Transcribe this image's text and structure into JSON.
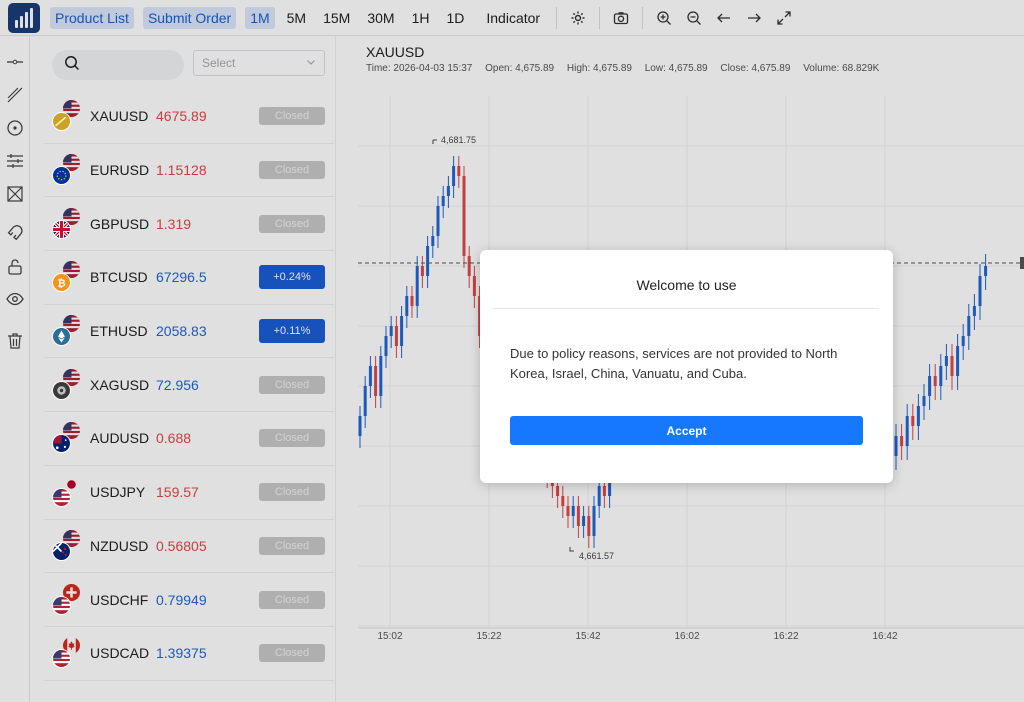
{
  "toolbar": {
    "nav": [
      "Product List",
      "Submit Order"
    ],
    "timeframes": [
      "1M",
      "5M",
      "15M",
      "30M",
      "1H",
      "1D"
    ],
    "active_timeframe": "1M",
    "indicator_label": "Indicator",
    "icons": [
      "settings-icon",
      "camera-icon",
      "zoom-in-icon",
      "zoom-out-icon",
      "arrow-left-icon",
      "arrow-right-icon",
      "fullscreen-icon"
    ]
  },
  "tools": [
    "horizontal-line-icon",
    "trend-line-icon",
    "circle-target-icon",
    "parallel-lines-icon",
    "box-cross-icon",
    "magnet-icon",
    "unlock-icon",
    "eye-icon",
    "trash-icon"
  ],
  "panel": {
    "search_placeholder": "",
    "select_placeholder": "Select",
    "symbols": [
      {
        "symbol": "XAUUSD",
        "price": "4675.89",
        "color": "red",
        "status": "Closed"
      },
      {
        "symbol": "EURUSD",
        "price": "1.15128",
        "color": "red",
        "status": "Closed"
      },
      {
        "symbol": "GBPUSD",
        "price": "1.319",
        "color": "red",
        "status": "Closed"
      },
      {
        "symbol": "BTCUSD",
        "price": "67296.5",
        "color": "blue",
        "status": "+0.24%"
      },
      {
        "symbol": "ETHUSD",
        "price": "2058.83",
        "color": "blue",
        "status": "+0.11%"
      },
      {
        "symbol": "XAGUSD",
        "price": "72.956",
        "color": "blue",
        "status": "Closed"
      },
      {
        "symbol": "AUDUSD",
        "price": "0.688",
        "color": "red",
        "status": "Closed"
      },
      {
        "symbol": "USDJPY",
        "price": "159.57",
        "color": "red",
        "status": "Closed"
      },
      {
        "symbol": "NZDUSD",
        "price": "0.56805",
        "color": "red",
        "status": "Closed"
      },
      {
        "symbol": "USDCHF",
        "price": "0.79949",
        "color": "blue",
        "status": "Closed"
      },
      {
        "symbol": "USDCAD",
        "price": "1.39375",
        "color": "blue",
        "status": "Closed"
      }
    ]
  },
  "chart": {
    "symbol": "XAUUSD",
    "time": "Time: 2026-04-03 15:37",
    "open": "Open: 4,675.89",
    "high": "High: 4,675.89",
    "low": "Low: 4,675.89",
    "close": "Close: 4,675.89",
    "volume": "Volume: 68.829K",
    "max_label": "4,681.75",
    "min_label": "4,661.57",
    "x_ticks": [
      "15:02",
      "15:22",
      "15:42",
      "16:02",
      "16:22",
      "16:42"
    ]
  },
  "modal": {
    "title": "Welcome to use",
    "body": "Due to policy reasons, services are not provided to North Korea, Israel, China, Vanuatu, and Cuba.",
    "button": "Accept"
  },
  "colors": {
    "accent": "#1677ff",
    "up": "#2166d4",
    "down": "#e04848",
    "badge_up": "#1b5ed6",
    "badge_closed": "#c8c8c8"
  }
}
